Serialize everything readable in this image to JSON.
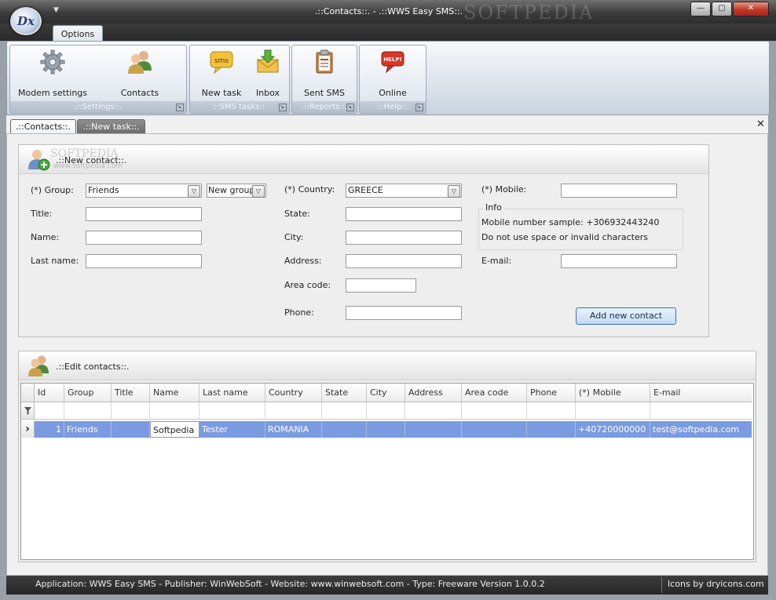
{
  "window": {
    "title": ".::Contacts::. - .::WWS Easy SMS::.",
    "watermark": "SOFTPEDIA",
    "logo_text": "Dx",
    "minimize": "—",
    "maximize": "▢",
    "close": "✕"
  },
  "ribbon": {
    "tab": "Options",
    "groups": [
      {
        "label": ".::Settings::.",
        "buttons": [
          "Modem settings",
          "Contacts"
        ]
      },
      {
        "label": ".::SMS tasks::.",
        "buttons": [
          "New task",
          "Inbox"
        ]
      },
      {
        "label": ".::Reports::.",
        "buttons": [
          "Sent SMS"
        ]
      },
      {
        "label": ".::Help::.",
        "buttons": [
          "Online"
        ]
      }
    ],
    "icons": {
      "modem": "gear-icon",
      "contacts": "users-icon",
      "new_task": "sms-bubble-icon",
      "inbox": "inbox-arrow-icon",
      "sent_sms": "clipboard-icon",
      "online": "help-bubble-icon"
    },
    "sms_badge": "sms",
    "help_badge": "HELP!"
  },
  "doc_tabs": [
    ".::Contacts::.",
    ".::New task::."
  ],
  "doc_close": "✕",
  "new_contact": {
    "title": ".::New contact::.",
    "watermark": "SOFTPEDIA",
    "watermark_url": "www.softpedia.com",
    "group_label": "(*) Group:",
    "group_value": "Friends",
    "new_group": "New group",
    "title_label": "Title:",
    "name_label": "Name:",
    "last_name_label": "Last name:",
    "country_label": "(*) Country:",
    "country_value": "GREECE",
    "state_label": "State:",
    "city_label": "City:",
    "address_label": "Address:",
    "area_code_label": "Area code:",
    "phone_label": "Phone:",
    "mobile_label": "(*) Mobile:",
    "info_legend": "Info",
    "info_line1": "Mobile number sample: +306932443240",
    "info_line2": "Do not use space or invalid characters",
    "email_label": "E-mail:",
    "add_button": "Add new contact"
  },
  "edit_contacts": {
    "title": ".::Edit contacts::.",
    "columns": [
      "Id",
      "Group",
      "Title",
      "Name",
      "Last name",
      "Country",
      "State",
      "City",
      "Address",
      "Area code",
      "Phone",
      "(*) Mobile",
      "E-mail"
    ],
    "filter_icon": "filter-icon",
    "row_pointer": "›",
    "rows": [
      {
        "id": "1",
        "group": "Friends",
        "title": "",
        "name": "Softpedia",
        "last_name": "Tester",
        "country": "ROMANIA",
        "state": "",
        "city": "",
        "address": "",
        "area_code": "",
        "phone": "",
        "mobile": "+40720000000",
        "email": "test@softpedia.com"
      }
    ]
  },
  "status": {
    "text": "Application: WWS Easy SMS - Publisher: WinWebSoft - Website: www.winwebsoft.com - Type: Freeware  Version 1.0.0.2",
    "right": "Icons by dryicons.com"
  }
}
